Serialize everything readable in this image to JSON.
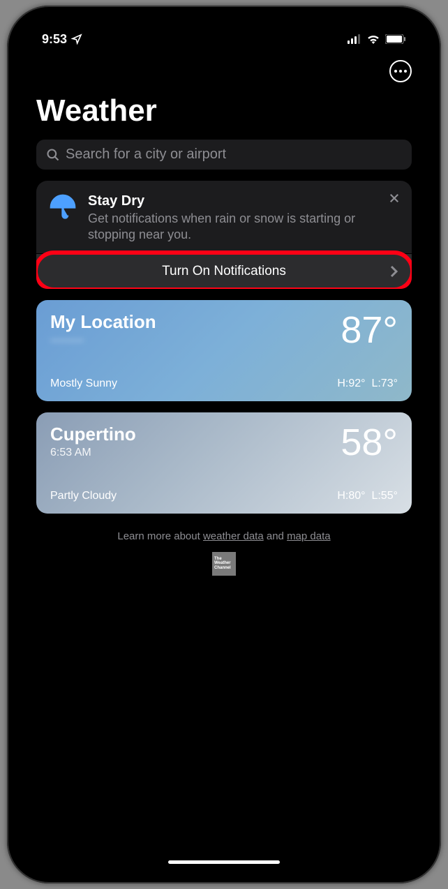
{
  "status": {
    "time": "9:53"
  },
  "title": "Weather",
  "search": {
    "placeholder": "Search for a city or airport"
  },
  "promo": {
    "heading": "Stay Dry",
    "body": "Get notifications when rain or snow is starting or stopping near you.",
    "button": "Turn On Notifications"
  },
  "locations": [
    {
      "name": "My Location",
      "subtitle": "———",
      "temp": "87°",
      "condition": "Mostly Sunny",
      "hi": "H:92°",
      "lo": "L:73°"
    },
    {
      "name": "Cupertino",
      "subtitle": "6:53 AM",
      "temp": "58°",
      "condition": "Partly Cloudy",
      "hi": "H:80°",
      "lo": "L:55°"
    }
  ],
  "footer": {
    "prefix": "Learn more about ",
    "link1": "weather data",
    "mid": " and ",
    "link2": "map data"
  }
}
